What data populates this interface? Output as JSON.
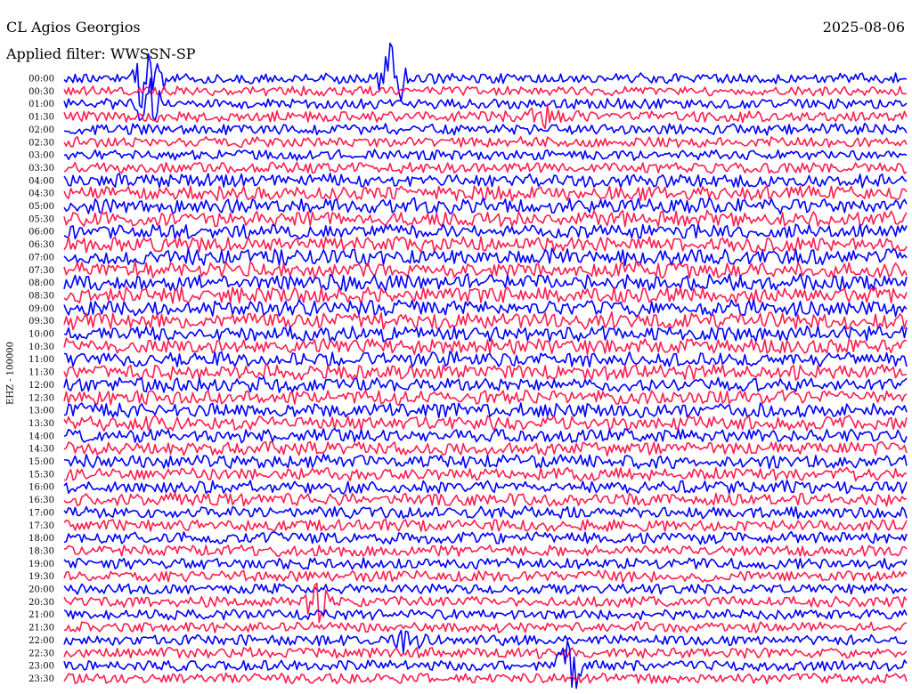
{
  "header": {
    "station": "CL Agios Georgios",
    "filter": "Applied filter: WWSSN-SP",
    "date": "2025-08-06"
  },
  "colors": {
    "trace_a": "#0000ff",
    "trace_b": "#ff1f4f",
    "background": "#ffffff",
    "text": "#000000"
  },
  "chart_data": {
    "type": "line",
    "title": "CL Agios Georgios",
    "subtitle": "Applied filter: WWSSN-SP",
    "ylabel": "EHZ - 100000",
    "xlabel": "",
    "grid": false,
    "series_colors_alternate": [
      "#0000ff",
      "#ff1f4f"
    ],
    "row_labels": [
      "00:00",
      "00:30",
      "01:00",
      "01:30",
      "02:00",
      "02:30",
      "03:00",
      "03:30",
      "04:00",
      "04:30",
      "05:00",
      "05:30",
      "06:00",
      "06:30",
      "07:00",
      "07:30",
      "08:00",
      "08:30",
      "09:00",
      "09:30",
      "10:00",
      "10:30",
      "11:00",
      "11:30",
      "12:00",
      "12:30",
      "13:00",
      "13:30",
      "14:00",
      "14:30",
      "15:00",
      "15:30",
      "16:00",
      "16:30",
      "17:00",
      "17:30",
      "18:00",
      "18:30",
      "19:00",
      "19:30",
      "20:00",
      "20:30",
      "21:00",
      "21:30",
      "22:00",
      "22:30",
      "23:00",
      "23:30"
    ],
    "activity_level": [
      0.3,
      0.25,
      0.3,
      0.35,
      0.35,
      0.3,
      0.3,
      0.35,
      0.5,
      0.55,
      0.6,
      0.6,
      0.55,
      0.6,
      0.65,
      0.65,
      0.65,
      0.65,
      0.65,
      0.65,
      0.6,
      0.6,
      0.6,
      0.6,
      0.55,
      0.55,
      0.55,
      0.55,
      0.5,
      0.5,
      0.5,
      0.45,
      0.45,
      0.45,
      0.4,
      0.4,
      0.4,
      0.35,
      0.35,
      0.35,
      0.3,
      0.3,
      0.3,
      0.3,
      0.3,
      0.3,
      0.3,
      0.3
    ],
    "events": [
      {
        "time": "00:00",
        "position": 0.1,
        "amplitude": 6
      },
      {
        "time": "00:00",
        "position": 0.39,
        "amplitude": 3
      },
      {
        "time": "01:00",
        "position": 0.1,
        "amplitude": 2
      },
      {
        "time": "01:30",
        "position": 0.57,
        "amplitude": 1.2
      },
      {
        "time": "20:30",
        "position": 0.3,
        "amplitude": 1.5
      },
      {
        "time": "22:00",
        "position": 0.41,
        "amplitude": 1.5
      },
      {
        "time": "23:00",
        "position": 0.6,
        "amplitude": 2.5
      }
    ]
  }
}
